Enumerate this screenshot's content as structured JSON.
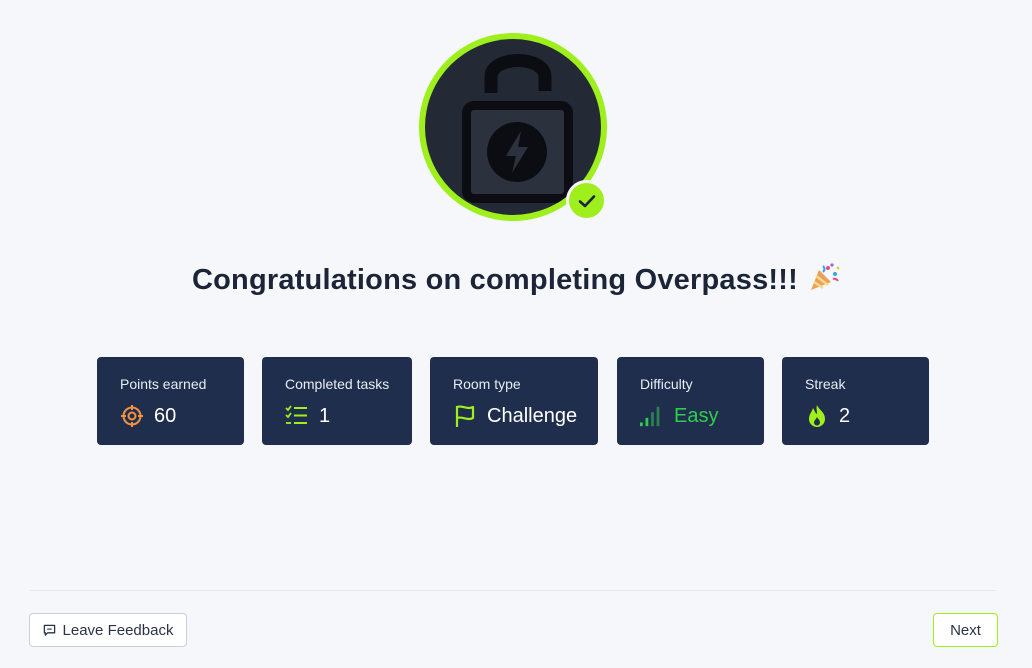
{
  "completion": {
    "title": "Congratulations on completing Overpass!!!",
    "title_icon": "party-popper-icon",
    "badge_icon": "unlocked-padlock-icon",
    "badge_check_icon": "check-icon"
  },
  "stats": [
    {
      "label": "Points earned",
      "value": "60",
      "icon": "target-icon",
      "icon_color": "#f5923e"
    },
    {
      "label": "Completed tasks",
      "value": "1",
      "icon": "task-list-icon",
      "icon_color": "#9fef1d"
    },
    {
      "label": "Room type",
      "value": "Challenge",
      "icon": "flag-icon",
      "icon_color": "#9fef1d"
    },
    {
      "label": "Difficulty",
      "value": "Easy",
      "icon": "signal-bars-icon",
      "icon_color": "#2fcc4e"
    },
    {
      "label": "Streak",
      "value": "2",
      "icon": "flame-icon",
      "icon_color": "#9fef1d"
    }
  ],
  "footer": {
    "feedback_label": "Leave Feedback",
    "feedback_icon": "message-square-icon",
    "next_label": "Next"
  },
  "colors": {
    "accent": "#9fef1d",
    "card_bg": "#1f2e4d",
    "page_bg": "#f6f7fb",
    "easy": "#2fcc4e"
  }
}
